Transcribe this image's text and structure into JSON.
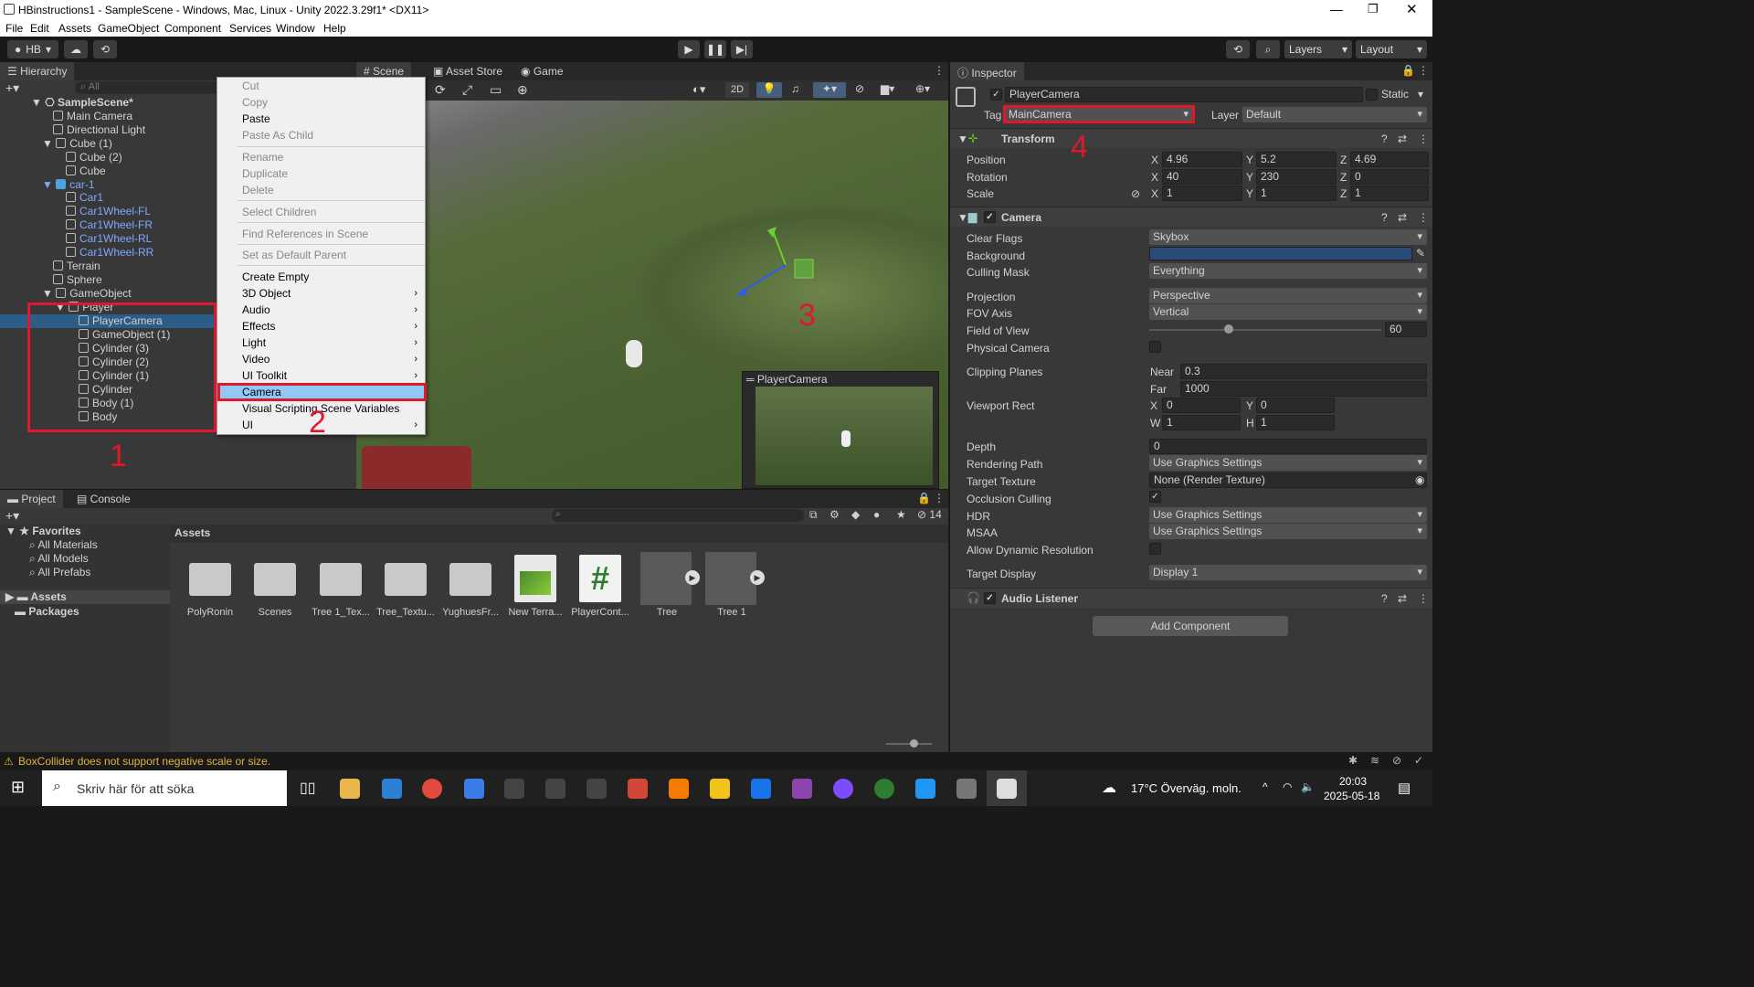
{
  "window": {
    "title": "HBinstructions1 - SampleScene - Windows, Mac, Linux - Unity 2022.3.29f1* <DX11>"
  },
  "menu": [
    "File",
    "Edit",
    "Assets",
    "GameObject",
    "Component",
    "Services",
    "Window",
    "Help"
  ],
  "toolbar": {
    "account": "HB",
    "layers": "Layers",
    "layout": "Layout"
  },
  "hierarchy": {
    "tab": "Hierarchy",
    "search_placeholder": "All",
    "items": [
      "SampleScene*",
      "Main Camera",
      "Directional Light",
      "Cube (1)",
      "Cube (2)",
      "Cube",
      "car-1",
      "Car1",
      "Car1Wheel-FL",
      "Car1Wheel-FR",
      "Car1Wheel-RL",
      "Car1Wheel-RR",
      "Terrain",
      "Sphere",
      "GameObject",
      "Player",
      "PlayerCamera",
      "GameObject (1)",
      "Cylinder (3)",
      "Cylinder (2)",
      "Cylinder (1)",
      "Cylinder",
      "Body (1)",
      "Body"
    ]
  },
  "context_menu": [
    "Cut",
    "Copy",
    "Paste",
    "Paste As Child",
    "Rename",
    "Duplicate",
    "Delete",
    "Select Children",
    "Find References in Scene",
    "Set as Default Parent",
    "Create Empty",
    "3D Object",
    "Audio",
    "Effects",
    "Light",
    "Video",
    "UI Toolkit",
    "Camera",
    "Visual Scripting Scene Variables",
    "UI"
  ],
  "scene": {
    "tabs": [
      "Scene",
      "Asset Store",
      "Game"
    ],
    "btn2d": "2D",
    "preview_title": "PlayerCamera"
  },
  "inspector": {
    "tab": "Inspector",
    "name": "PlayerCamera",
    "static": "Static",
    "tag_label": "Tag",
    "tag": "MainCamera",
    "layer_label": "Layer",
    "layer": "Default",
    "transform": {
      "title": "Transform",
      "position": [
        "4.96",
        "5.2",
        "4.69"
      ],
      "rotation": [
        "40",
        "230",
        "0"
      ],
      "scale": [
        "1",
        "1",
        "1"
      ]
    },
    "labels": {
      "position": "Position",
      "rotation": "Rotation",
      "scale": "Scale",
      "x": "X",
      "y": "Y",
      "z": "Z",
      "w": "W",
      "h": "H",
      "near": "Near",
      "far": "Far"
    },
    "camera": {
      "title": "Camera",
      "rows": [
        {
          "label": "Clear Flags",
          "value": "Skybox"
        },
        {
          "label": "Background",
          "value": ""
        },
        {
          "label": "Culling Mask",
          "value": "Everything"
        },
        {
          "label": "Projection",
          "value": "Perspective"
        },
        {
          "label": "FOV Axis",
          "value": "Vertical"
        },
        {
          "label": "Field of View",
          "value": "60"
        },
        {
          "label": "Physical Camera",
          "value": ""
        },
        {
          "label": "Clipping Planes",
          "value": ""
        },
        {
          "label": "Viewport Rect",
          "value": ""
        },
        {
          "label": "Depth",
          "value": "0"
        },
        {
          "label": "Rendering Path",
          "value": "Use Graphics Settings"
        },
        {
          "label": "Target Texture",
          "value": "None (Render Texture)"
        },
        {
          "label": "Occlusion Culling",
          "value": ""
        },
        {
          "label": "HDR",
          "value": "Use Graphics Settings"
        },
        {
          "label": "MSAA",
          "value": "Use Graphics Settings"
        },
        {
          "label": "Allow Dynamic Resolution",
          "value": ""
        },
        {
          "label": "Target Display",
          "value": "Display 1"
        }
      ],
      "near": "0.3",
      "far": "1000",
      "vx": "0",
      "vy": "0",
      "vw": "1",
      "vh": "1"
    },
    "audio_listener": "Audio Listener",
    "add_component": "Add Component"
  },
  "project": {
    "tabs": [
      "Project",
      "Console"
    ],
    "favorites": "Favorites",
    "fav_items": [
      "All Materials",
      "All Models",
      "All Prefabs"
    ],
    "assets_root": "Assets",
    "packages": "Packages",
    "breadcrumb": "Assets",
    "hidden_count": "14",
    "assets": [
      "PolyRonin",
      "Scenes",
      "Tree 1_Tex...",
      "Tree_Textu...",
      "YughuesFr...",
      "New Terra...",
      "PlayerCont...",
      "Tree",
      "Tree 1"
    ]
  },
  "status": "BoxCollider does not support negative scale or size.",
  "taskbar": {
    "search": "Skriv här för att söka",
    "weather": "17°C  Överväg. moln.",
    "time": "20:03",
    "date": "2025-05-18"
  },
  "annotations": [
    "1",
    "2",
    "3",
    "4"
  ]
}
